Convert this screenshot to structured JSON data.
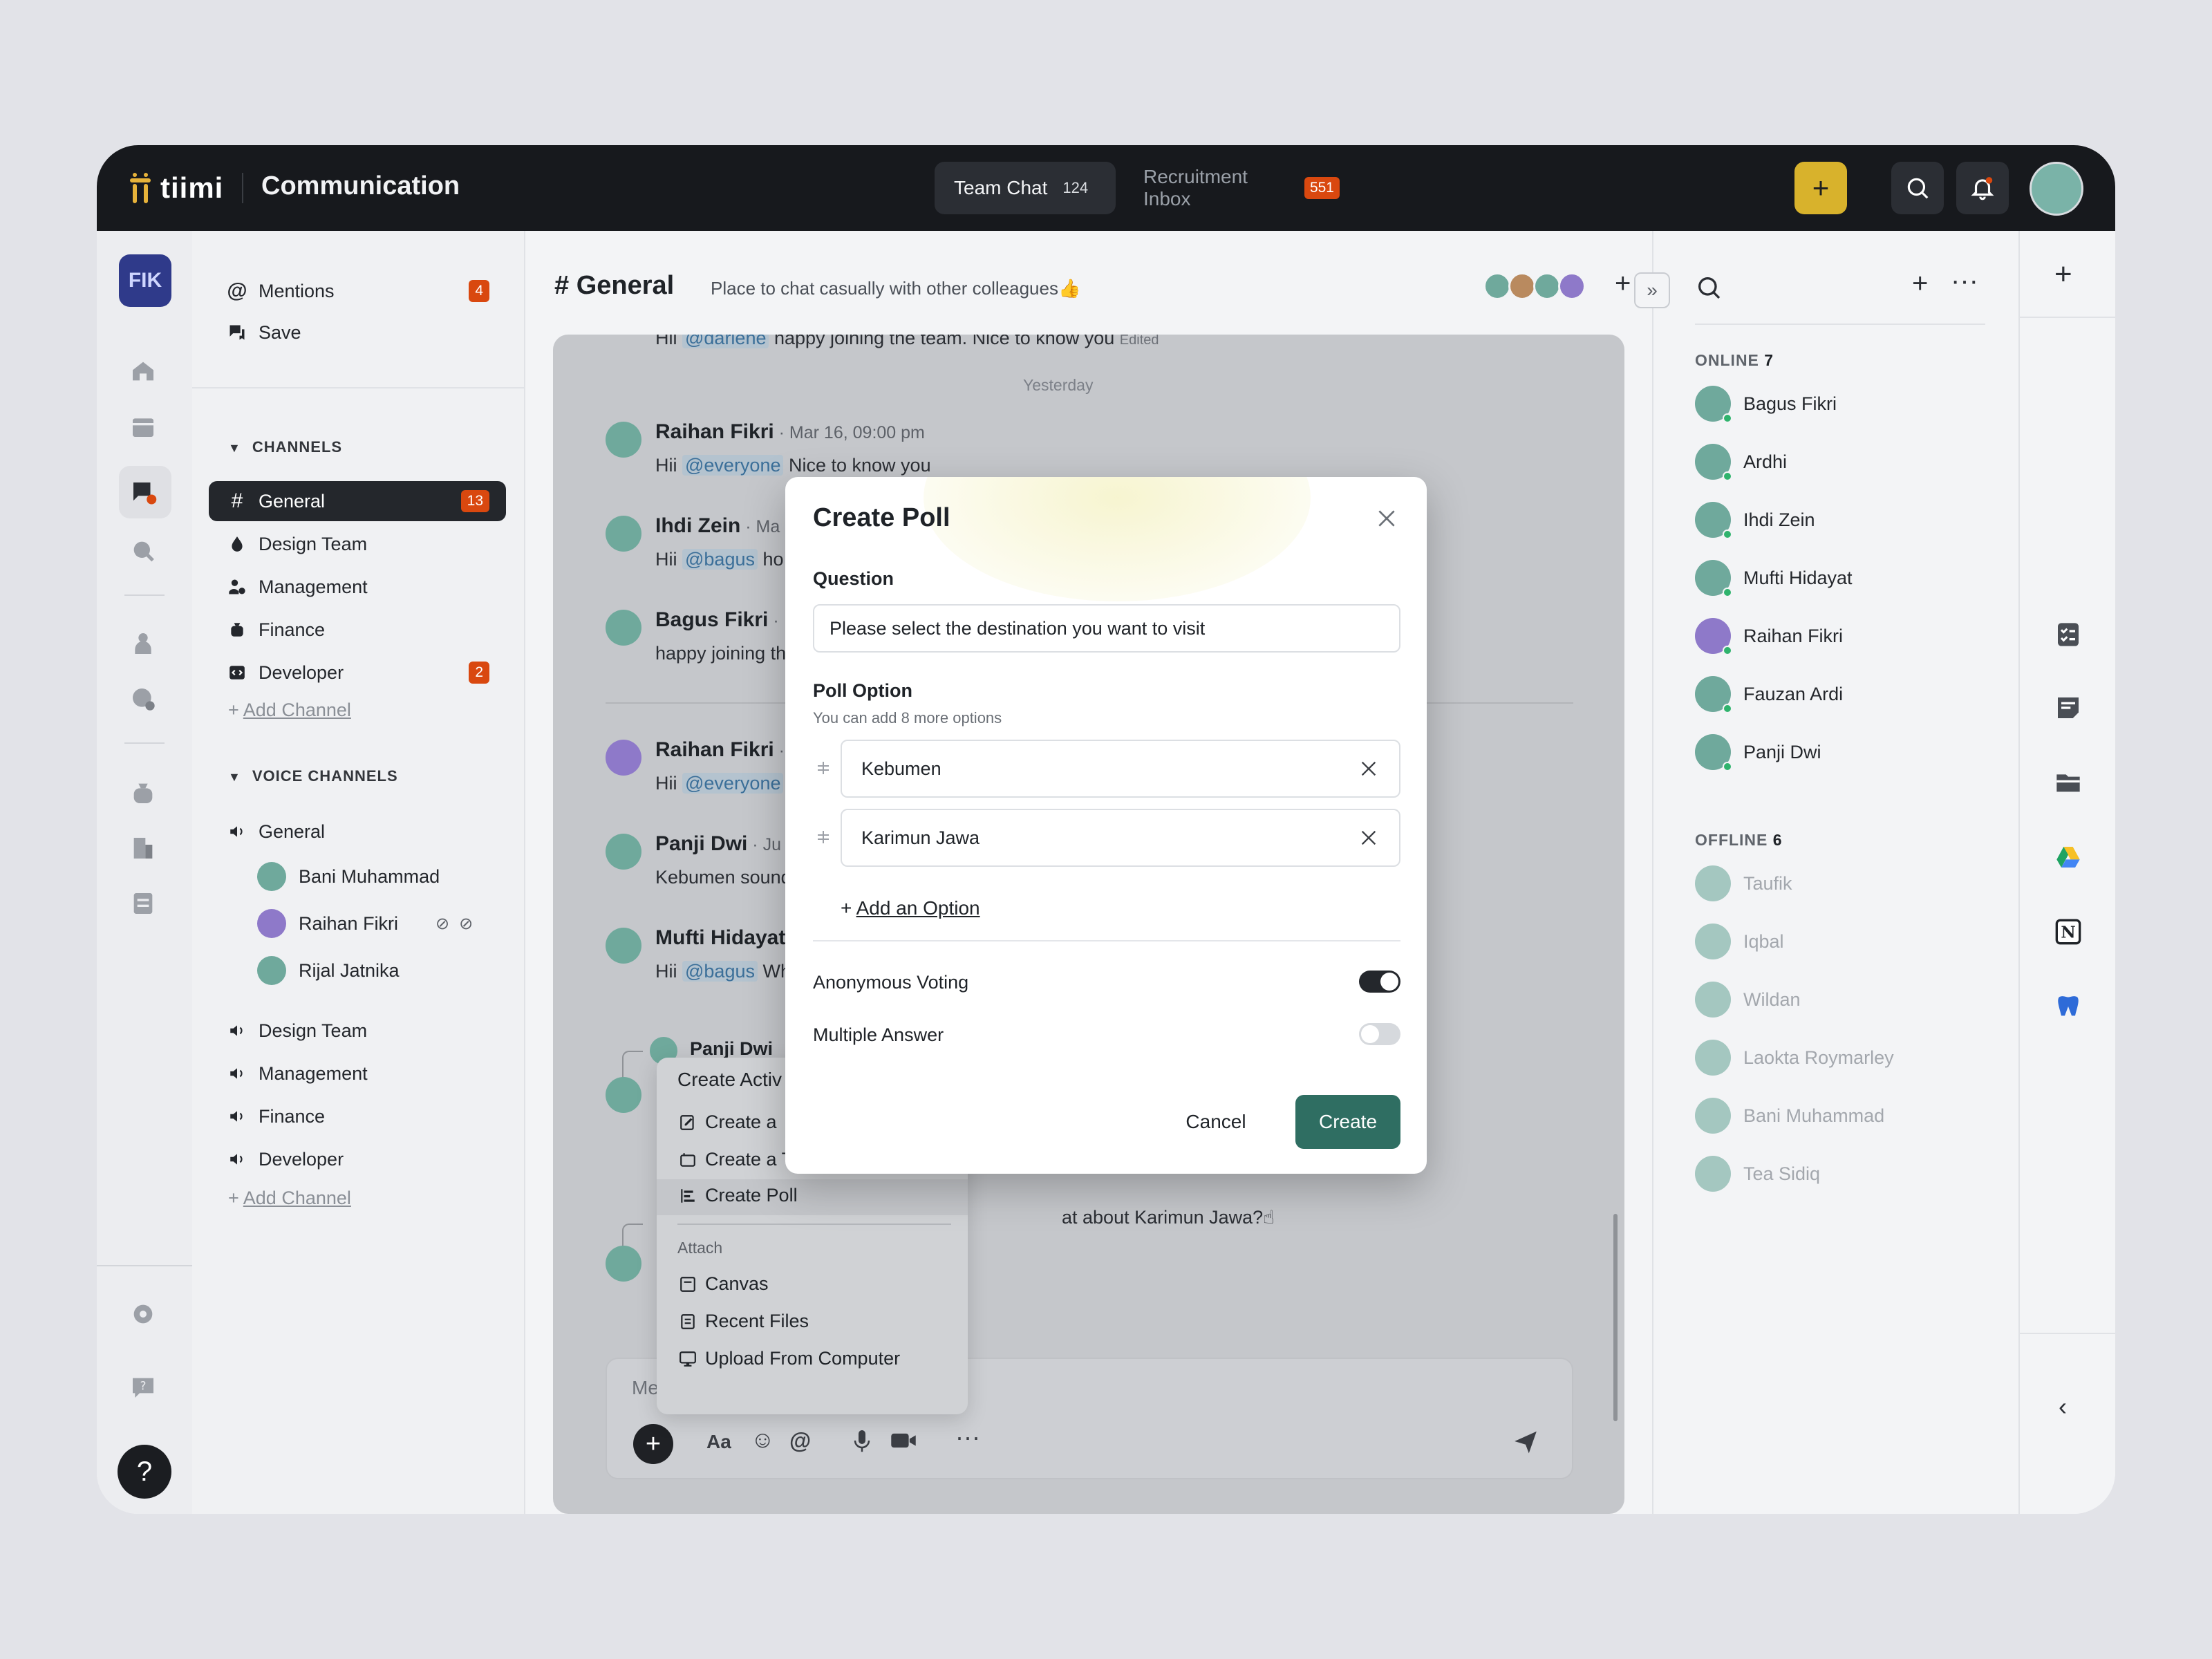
{
  "header": {
    "logo_text": "tiimi",
    "app_title": "Communication",
    "tabs": [
      {
        "label": "Team Chat",
        "count": "124"
      },
      {
        "label": "Recruitment Inbox",
        "count": "551"
      }
    ],
    "add_label": "+"
  },
  "workspace": {
    "label": "FIK"
  },
  "rail": {
    "help_label": "?"
  },
  "sidebar": {
    "mentions": {
      "label": "Mentions",
      "count": "4"
    },
    "save": {
      "label": "Save"
    },
    "channels_header": "CHANNELS",
    "channels": [
      {
        "label": "General",
        "count": "13"
      },
      {
        "label": "Design Team"
      },
      {
        "label": "Management"
      },
      {
        "label": "Finance"
      },
      {
        "label": "Developer",
        "count": "2"
      }
    ],
    "add_channel": "Add Channel",
    "voice_header": "VOICE CHANNELS",
    "voice_general": "General",
    "voice_members": [
      "Bani Muhammad",
      "Raihan Fikri",
      "Rijal Jatnika"
    ],
    "voice_channels": [
      "Design Team",
      "Management",
      "Finance",
      "Developer"
    ],
    "add_channel_2": "Add Channel"
  },
  "main": {
    "channel_title": "# General",
    "channel_desc": "Place to chat casually with other colleagues👍",
    "day_label": "Yesterday",
    "top_msg": {
      "prefix": "Hii ",
      "mention": "@darlene",
      "text": " happy joining the team. Nice to know you",
      "edited": "Edited"
    },
    "messages": [
      {
        "name": "Raihan Fikri",
        "meta": " · Mar 16, 09:00 pm",
        "prefix": "Hii ",
        "mention": "@everyone",
        "text": " Nice to know you"
      },
      {
        "name": "Ihdi Zein",
        "meta": " · Ma",
        "prefix": "Hii ",
        "mention": "@bagus",
        "text": " ho"
      },
      {
        "name": "Bagus Fikri",
        "meta": " ·",
        "prefix": "",
        "mention": "",
        "text": "happy joining th"
      },
      {
        "name": "Raihan Fikri",
        "meta": " ·",
        "prefix": "Hii ",
        "mention": "@everyone",
        "text": ""
      },
      {
        "name": "Panji Dwi",
        "meta": " · Ju",
        "prefix": "",
        "mention": "",
        "text": "Kebumen sound"
      },
      {
        "name": "Mufti Hidayat",
        "meta": "",
        "prefix": "Hii ",
        "mention": "@bagus",
        "text": " Wh"
      }
    ],
    "reply_name": "Panji Dwi",
    "karimun_text": "at about Karimun Jawa?☝",
    "composer_placeholder": "Me"
  },
  "context_menu": {
    "header": "Create Activ",
    "items": [
      "Create a",
      "Create a Text Canvases",
      "Create Poll"
    ],
    "attach_label": "Attach",
    "attach_items": [
      "Canvas",
      "Recent Files",
      "Upload From Computer"
    ]
  },
  "right_panel": {
    "online_label": "ONLINE",
    "online_count": "7",
    "online_users": [
      "Bagus Fikri",
      "Ardhi",
      "Ihdi Zein",
      "Mufti Hidayat",
      "Raihan Fikri",
      "Fauzan Ardi",
      "Panji Dwi"
    ],
    "offline_label": "OFFLINE",
    "offline_count": "6",
    "offline_users": [
      "Taufik",
      "Iqbal",
      "Wildan",
      "Laokta Roymarley",
      "Bani Muhammad",
      "Tea Sidiq"
    ]
  },
  "modal": {
    "title": "Create Poll",
    "question_label": "Question",
    "question_value": "Please select the destination you want to visit",
    "option_label": "Poll Option",
    "option_sub": "You can add 8 more options",
    "options": [
      "Kebumen",
      "Karimun Jawa"
    ],
    "add_option": "Add an Option",
    "anonymous_label": "Anonymous Voting",
    "anonymous_on": true,
    "multiple_label": "Multiple Answer",
    "multiple_on": false,
    "cancel_label": "Cancel",
    "create_label": "Create"
  },
  "colors": {
    "accent": "#2f6e62",
    "badge": "#d9480f",
    "topbar": "#17191d",
    "add_button": "#d8b22c"
  }
}
